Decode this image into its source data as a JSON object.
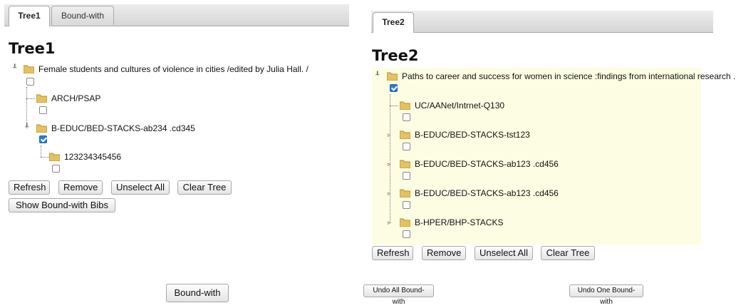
{
  "left": {
    "tabs": [
      {
        "label": "Tree1"
      },
      {
        "label": "Bound-with"
      }
    ],
    "title": "Tree1",
    "root": {
      "label": "Female students and cultures of violence in cities /edited by Julia Hall. /"
    },
    "children": [
      {
        "label": "ARCH/PSAP"
      },
      {
        "label": "B-EDUC/BED-STACKS-ab234 .cd345"
      },
      {
        "label": "123234345456"
      }
    ],
    "buttons": {
      "refresh": "Refresh",
      "remove": "Remove",
      "unselect": "Unselect All",
      "clear": "Clear Tree",
      "show_bound": "Show Bound-with Bibs"
    }
  },
  "right": {
    "tabs": [
      {
        "label": "Tree2"
      }
    ],
    "title": "Tree2",
    "root": {
      "label": "Paths to career and success for women in science :findings from international research ..."
    },
    "children": [
      {
        "label": "UC/AANet/Intrnet-Q130"
      },
      {
        "label": "B-EDUC/BED-STACKS-tst123"
      },
      {
        "label": "B-EDUC/BED-STACKS-ab123 .cd456"
      },
      {
        "label": "B-EDUC/BED-STACKS-ab123 .cd456"
      },
      {
        "label": "B-HPER/BHP-STACKS"
      }
    ],
    "buttons": {
      "refresh": "Refresh",
      "remove": "Remove",
      "unselect": "Unselect All",
      "clear": "Clear Tree"
    }
  },
  "footer": {
    "bound_with": "Bound-with",
    "undo_all": "Undo All Bound-with",
    "undo_one": "Undo One Bound-with"
  },
  "colors": {
    "highlight": "#fdfde3",
    "checkbox_checked": "#2a7ad8"
  },
  "icons": {
    "folder": "folder-icon",
    "expander": "tree-expander-icon"
  }
}
